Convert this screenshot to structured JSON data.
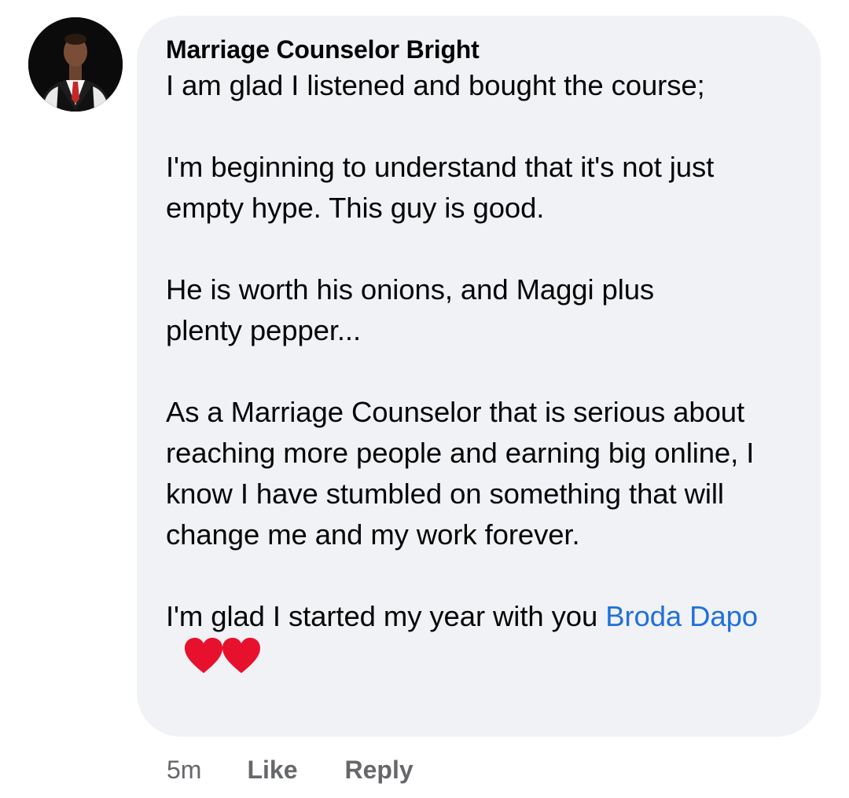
{
  "comment": {
    "author": "Marriage Counselor Bright",
    "avatar_icon": "profile-photo",
    "paragraphs": [
      "I am glad I listened and bought the course;",
      "I'm beginning to understand that it's not just empty hype. This guy is good.",
      "He is worth his onions, and Maggi plus plenty pepper...",
      "As a Marriage Counselor that is serious about reaching more people and earning big online, I know I have stumbled on something that will change me and my work forever."
    ],
    "last_paragraph_text": "I'm glad I started my year with you ",
    "mention": "Broda Dapo",
    "reaction_icon": "red-heart-emoji",
    "reaction_count_shown": 2,
    "colors": {
      "bubble": "#f0f2f5",
      "mention": "#216fdb",
      "meta": "#65676b",
      "heart": "#e8112d"
    }
  },
  "actions": {
    "timestamp": "5m",
    "like_label": "Like",
    "reply_label": "Reply"
  }
}
